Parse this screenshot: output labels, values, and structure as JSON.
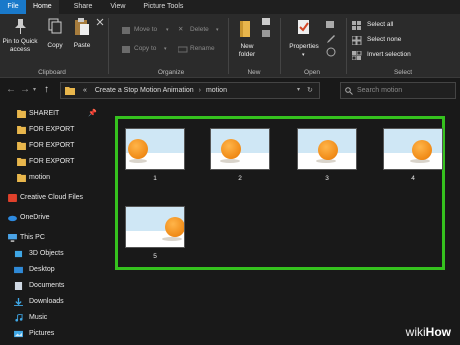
{
  "tabs": [
    "File",
    "Home",
    "Share",
    "View",
    "Picture Tools"
  ],
  "ribbon": {
    "clipboard": {
      "pin_label_1": "Pin to Quick",
      "pin_label_2": "access",
      "copy": "Copy",
      "paste": "Paste",
      "group": "Clipboard"
    },
    "organize": {
      "move_to": "Move to",
      "copy_to": "Copy to",
      "delete": "Delete",
      "rename": "Rename",
      "group": "Organize"
    },
    "new": {
      "new_folder_1": "New",
      "new_folder_2": "folder",
      "group": "New"
    },
    "open": {
      "properties": "Properties",
      "group": "Open"
    },
    "select": {
      "select_all": "Select all",
      "select_none": "Select none",
      "invert": "Invert selection",
      "group": "Select"
    }
  },
  "address": {
    "prefix": "«",
    "crumbs": [
      "Create a Stop Motion Animation",
      "motion"
    ],
    "search_placeholder": "Search motion"
  },
  "sidebar": {
    "items": [
      {
        "label": "SHAREIT",
        "icon": "folder-icon",
        "pinned": true
      },
      {
        "label": "FOR EXPORT",
        "icon": "folder-icon"
      },
      {
        "label": "FOR EXPORT",
        "icon": "folder-icon"
      },
      {
        "label": "FOR EXPORT",
        "icon": "folder-icon"
      },
      {
        "label": "motion",
        "icon": "folder-icon"
      },
      {
        "label": "Creative Cloud Files",
        "icon": "creative-cloud-icon"
      },
      {
        "label": "OneDrive",
        "icon": "onedrive-icon"
      },
      {
        "label": "This PC",
        "icon": "pc-icon"
      },
      {
        "label": "3D Objects",
        "icon": "cube-icon"
      },
      {
        "label": "Desktop",
        "icon": "desktop-icon"
      },
      {
        "label": "Documents",
        "icon": "documents-icon"
      },
      {
        "label": "Downloads",
        "icon": "downloads-icon"
      },
      {
        "label": "Music",
        "icon": "music-icon"
      },
      {
        "label": "Pictures",
        "icon": "pictures-icon"
      }
    ]
  },
  "files": [
    {
      "label": "1"
    },
    {
      "label": "2"
    },
    {
      "label": "3"
    },
    {
      "label": "4"
    },
    {
      "label": "5"
    }
  ],
  "colors": {
    "highlight": "#35c21e",
    "file_tab": "#1979ca",
    "folder": "#e8b64c",
    "ball": "#f08a16"
  },
  "watermark": {
    "a": "wiki",
    "b": "How"
  }
}
